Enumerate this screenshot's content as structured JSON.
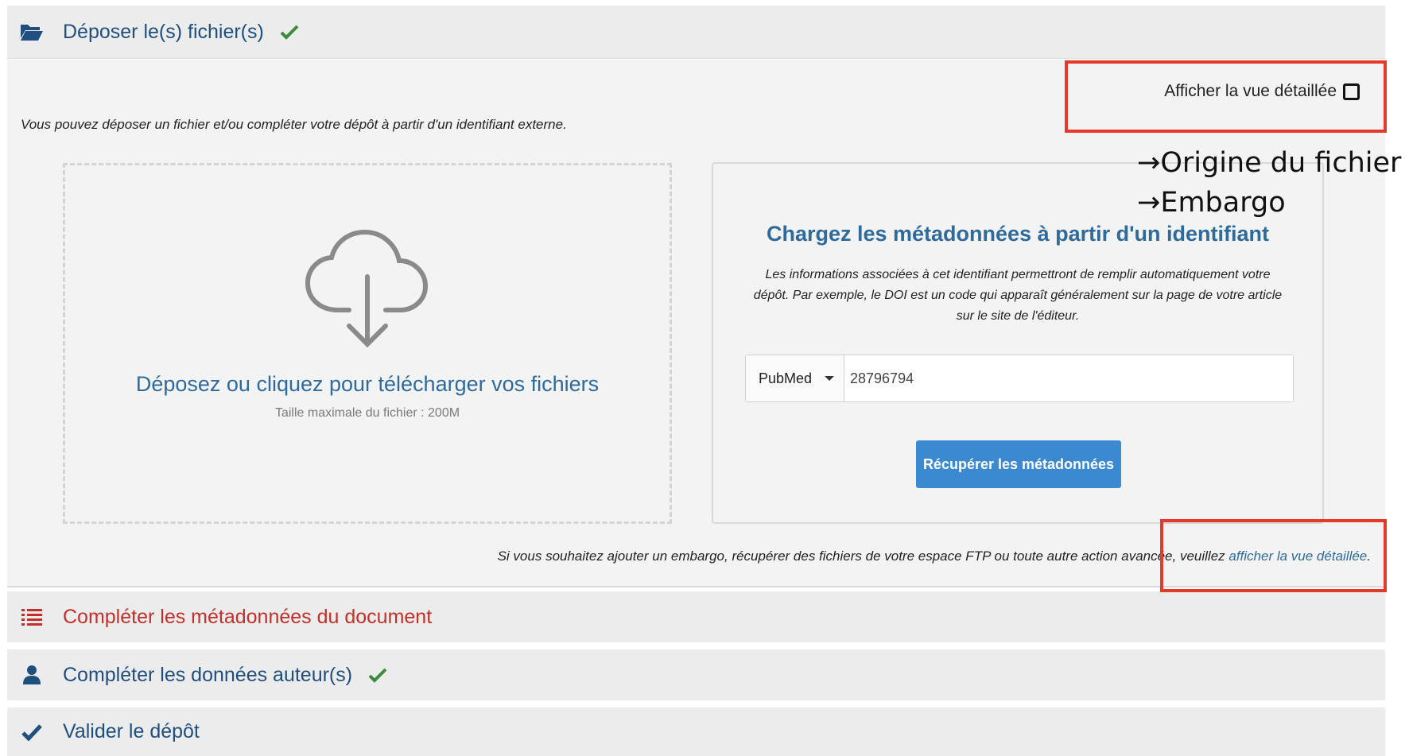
{
  "sections": {
    "depot": {
      "title": "Déposer le(s) fichier(s)",
      "completed": true,
      "icon": "folder-open-icon"
    },
    "meta": {
      "title": "Compléter les métadonnées du document",
      "completed": false,
      "icon": "list-icon"
    },
    "auteur": {
      "title": "Compléter les données auteur(s)",
      "completed": true,
      "icon": "user-icon"
    },
    "valider": {
      "title": "Valider le dépôt",
      "icon": "check-icon"
    }
  },
  "depot": {
    "detail_toggle_label": "Afficher la vue détaillée",
    "intro": "Vous pouvez déposer un fichier et/ou compléter votre dépôt à partir d'un identifiant externe.",
    "dropzone": {
      "label": "Déposez ou cliquez pour télécharger vos fichiers",
      "max_size": "Taille maximale du fichier : 200M"
    },
    "identifier": {
      "title": "Chargez les métadonnées à partir d'un identifiant",
      "description": "Les informations associées à cet identifiant permettront de remplir automatiquement votre dépôt. Par exemple, le DOI est un code qui apparaît généralement sur la page de votre article sur le site de l'éditeur.",
      "type_selected": "PubMed",
      "value": "28796794",
      "button": "Récupérer les métadonnées"
    },
    "embargo_note": "Si vous souhaitez ajouter un embargo, récupérer des fichiers de votre espace FTP ou toute autre action avancée, veuillez ",
    "embargo_link": "afficher la vue détaillée",
    "embargo_note_end": "."
  },
  "annotations": {
    "line1": "→Origine du fichier",
    "line2": "→Embargo",
    "highlight_color": "#e53a2a"
  },
  "colors": {
    "primary": "#2e6b9c",
    "button": "#3b89d0",
    "success": "#3c8a3c",
    "danger": "#c3302a"
  }
}
